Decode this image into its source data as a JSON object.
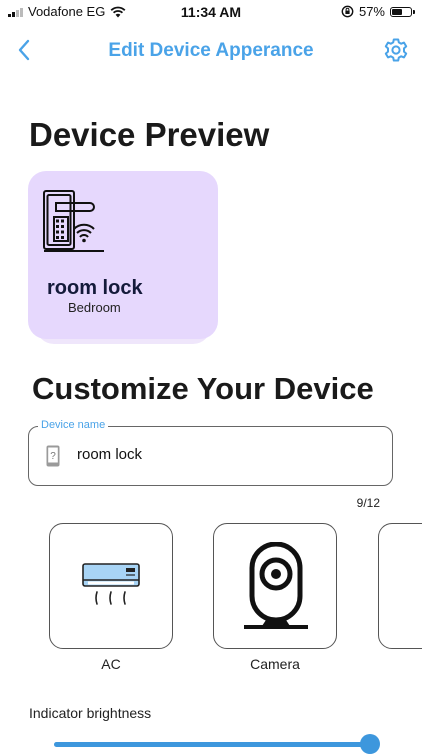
{
  "status_bar": {
    "carrier": "Vodafone EG",
    "time": "11:34 AM",
    "battery_percent": "57%",
    "battery_level": 0.57
  },
  "header": {
    "title": "Edit Device Apperance"
  },
  "preview_section": {
    "heading": "Device Preview",
    "device_name": "room lock",
    "room": "Bedroom",
    "card_color": "#e6d8fd"
  },
  "customize_section": {
    "heading": "Customize Your Device",
    "device_name_field": {
      "legend": "Device name",
      "value": "room lock"
    },
    "char_counter": "9/12"
  },
  "device_types": [
    {
      "label": "AC",
      "icon": "air-conditioner-icon"
    },
    {
      "label": "Camera",
      "icon": "security-camera-icon"
    }
  ],
  "brightness": {
    "label": "Indicator brightness",
    "value": 1.0
  },
  "colors": {
    "accent": "#4aa3e8",
    "slider": "#3d97dd"
  }
}
